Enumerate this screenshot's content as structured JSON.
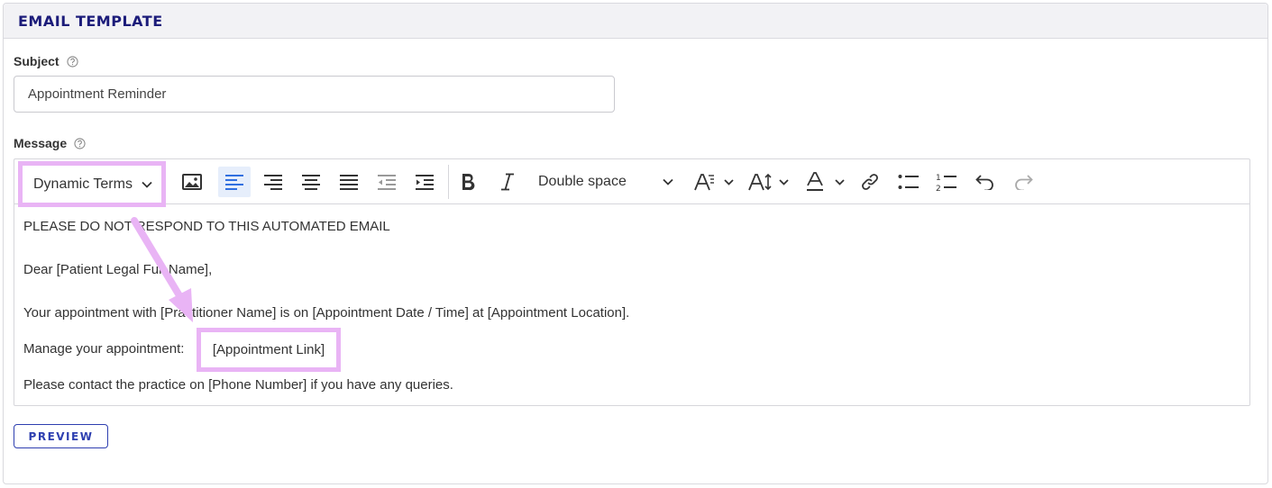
{
  "panel": {
    "title": "EMAIL TEMPLATE"
  },
  "subject": {
    "label": "Subject",
    "value": "Appointment Reminder"
  },
  "message": {
    "label": "Message",
    "toolbar": {
      "dynamic_terms_label": "Dynamic Terms",
      "line_spacing_value": "Double space",
      "icons": [
        "image-icon",
        "align-left-icon",
        "align-right-icon",
        "align-center-icon",
        "align-justify-icon",
        "outdent-icon",
        "indent-icon",
        "bold-icon",
        "italic-icon",
        "font-size-icon",
        "line-height-icon",
        "text-color-icon",
        "link-icon",
        "bulleted-list-icon",
        "numbered-list-icon",
        "undo-icon",
        "redo-icon"
      ]
    },
    "body": {
      "line1": "PLEASE DO NOT RESPOND TO THIS AUTOMATED EMAIL",
      "line2": "Dear [Patient Legal Full Name],",
      "line3": "Your appointment with [Practitioner Name] is on [Appointment Date / Time] at [Appointment Location].",
      "line4": "Manage your appointment:",
      "appointment_link": "[Appointment Link]",
      "line5": "Please contact the practice on [Phone Number] if you have any queries."
    }
  },
  "preview_label": "PREVIEW",
  "colors": {
    "title": "#1c1c7a",
    "highlight": "#e9b4f5",
    "primary": "#2e3fb0",
    "active_tool_bg": "#e6eefb",
    "active_tool_icon": "#2f6fe0"
  }
}
